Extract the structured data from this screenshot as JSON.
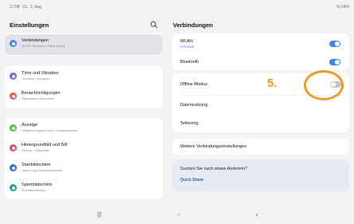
{
  "status": {
    "time": "17:08 · Di., 2. Aug.",
    "battery": "% 24%"
  },
  "left": {
    "title": "Einstellungen",
    "items": [
      {
        "title": "Verbindungen",
        "subtitle": "WLAN • Bluetooth • Offline-Modus",
        "color": "#3e86e8",
        "icon": "wifi-icon"
      },
      {
        "title": "Töne und Vibration",
        "subtitle": "Tonmodus • Klingelton",
        "color": "#7a63e0",
        "icon": "sound-icon"
      },
      {
        "title": "Benachrichtigungen",
        "subtitle": "Statusleiste • Nicht stören",
        "color": "#ea5a4c",
        "icon": "bell-icon"
      },
      {
        "title": "Anzeige",
        "subtitle": "Helligkeit • Augenkomfort • Navigationsleiste",
        "color": "#59b84a",
        "icon": "display-icon"
      },
      {
        "title": "Hintergrundbild und Stil",
        "subtitle": "Hintergr. • Farbpalette",
        "color": "#d9487e",
        "icon": "wallpaper-icon"
      },
      {
        "title": "Startbildschirm",
        "subtitle": "Layout • App-Symbolindikatoren",
        "color": "#2b6fd9",
        "icon": "home-icon"
      },
      {
        "title": "Sperrbildschirm",
        "subtitle": "Sperrbildschirmtyp",
        "color": "#1fa18a",
        "icon": "lock-icon"
      }
    ]
  },
  "right": {
    "title": "Verbindungen",
    "wlan": {
      "title": "WLAN",
      "subtitle": "FRITZ!WB"
    },
    "bluetooth": {
      "title": "Bluetooth"
    },
    "offline": {
      "title": "Offline-Modus"
    },
    "datennutzung": {
      "title": "Datennutzung"
    },
    "tethering": {
      "title": "Tethering"
    },
    "more": {
      "title": "Weitere Verbindungseinstellungen"
    },
    "suggest": {
      "question": "Suchen Sie nach etwas Anderem?",
      "link": "Quick Share"
    }
  },
  "annotation": {
    "label": "5."
  },
  "nav": {
    "recents": "|||",
    "home": "○",
    "back": "‹"
  }
}
